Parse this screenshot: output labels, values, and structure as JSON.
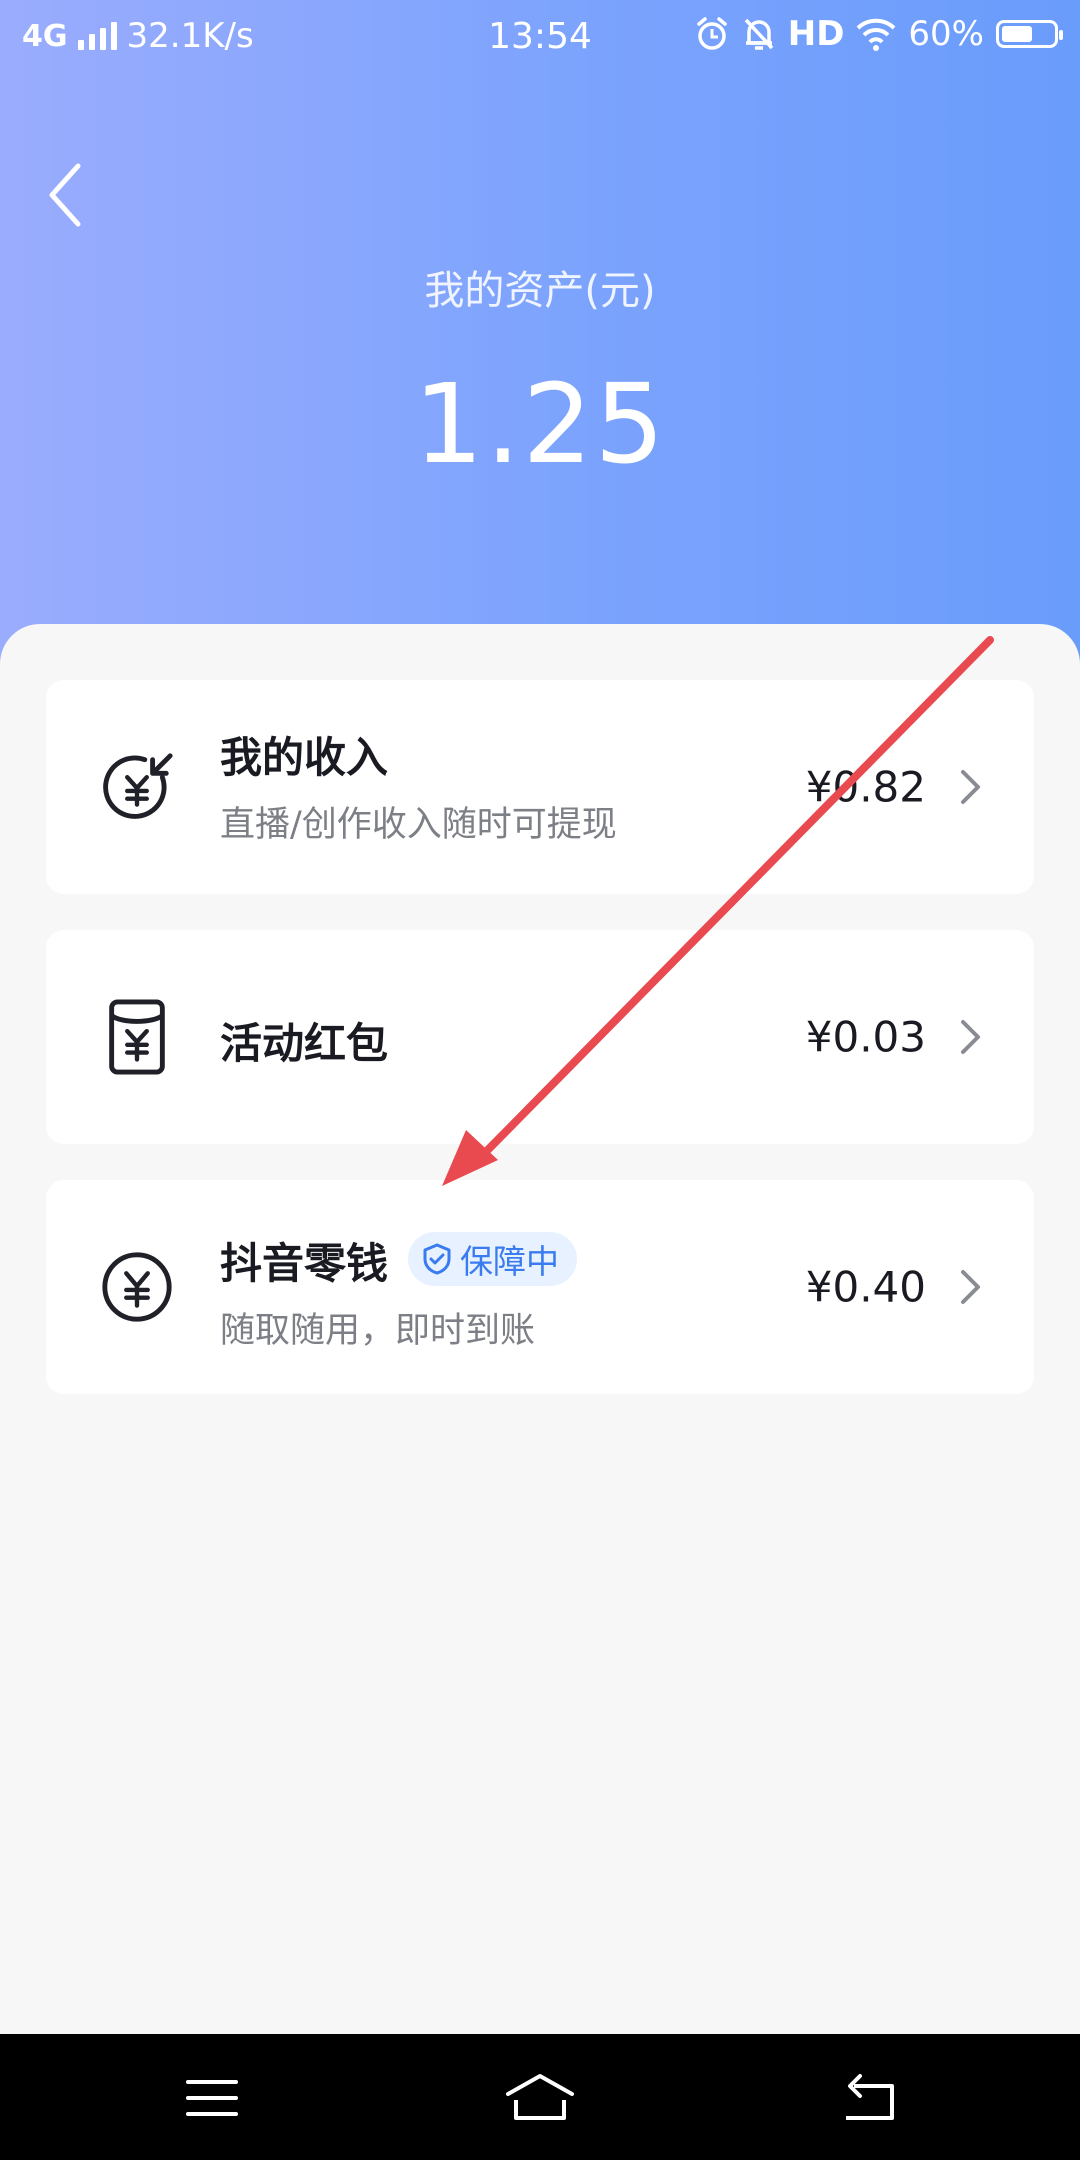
{
  "status_bar": {
    "network": "4G",
    "speed": "32.1K/s",
    "time": "13:54",
    "hd": "HD",
    "battery_percent": "60%",
    "battery_level": 0.6
  },
  "header": {
    "asset_label": "我的资产(元)",
    "asset_value": "1.25"
  },
  "cards": [
    {
      "title": "我的收入",
      "subtitle": "直播/创作收入随时可提现",
      "amount": "¥0.82",
      "icon": "income-yuan-icon"
    },
    {
      "title": "活动红包",
      "subtitle": "",
      "amount": "¥0.03",
      "icon": "red-packet-icon"
    },
    {
      "title": "抖音零钱",
      "subtitle": "随取随用，即时到账",
      "amount": "¥0.40",
      "icon": "yuan-coin-icon",
      "badge": "保障中"
    }
  ],
  "colors": {
    "header_gradient_start": "#9aacfd",
    "header_gradient_end": "#6a9cfc",
    "annotation_arrow": "#e84a4f",
    "badge_text": "#3a7cf0"
  }
}
